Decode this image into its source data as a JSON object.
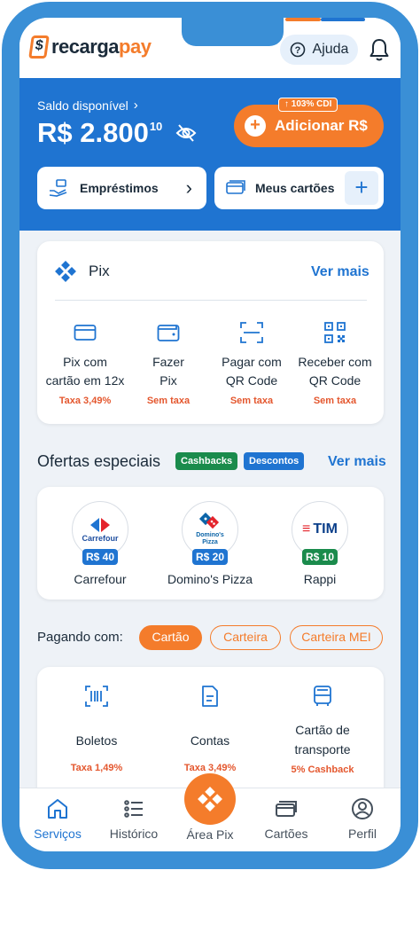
{
  "header": {
    "brand_a": "recarga",
    "brand_b": "pay",
    "help_label": "Ajuda"
  },
  "balance": {
    "label": "Saldo disponível",
    "amount": "R$ 2.800",
    "cents": "10",
    "cdi_badge": "103% CDI",
    "add_label": "Adicionar R$"
  },
  "quick": {
    "loans_label": "Empréstimos",
    "cards_label": "Meus cartões"
  },
  "pix": {
    "title": "Pix",
    "see_more": "Ver mais",
    "options": [
      {
        "line1": "Pix com",
        "line2": "cartão em 12x",
        "tax": "Taxa 3,49%",
        "icon": "card-icon"
      },
      {
        "line1": "Fazer",
        "line2": "Pix",
        "tax": "Sem taxa",
        "icon": "wallet-icon"
      },
      {
        "line1": "Pagar com",
        "line2": "QR Code",
        "tax": "Sem taxa",
        "icon": "scan-icon"
      },
      {
        "line1": "Receber com",
        "line2": "QR Code",
        "tax": "Sem taxa",
        "icon": "qr-code-icon"
      }
    ]
  },
  "offers": {
    "title": "Ofertas especiais",
    "tag_cashbacks": "Cashbacks",
    "tag_descontos": "Descontos",
    "see_more": "Ver mais",
    "items": [
      {
        "logo_text": "Carrefour",
        "price": "R$ 40",
        "name": "Carrefour",
        "price_color": "#1f74d1"
      },
      {
        "logo_text": "Domino's Pizza",
        "price": "R$ 20",
        "name": "Domino's Pizza",
        "price_color": "#1f74d1"
      },
      {
        "logo_text": "TIM",
        "price": "R$ 10",
        "name": "Rappi",
        "price_color": "#1a8b4c"
      }
    ]
  },
  "paying": {
    "label": "Pagando com:",
    "chips": [
      "Cartão",
      "Carteira",
      "Carteira MEI"
    ],
    "options": [
      {
        "line1": "Boletos",
        "line2": "",
        "tax": "Taxa 1,49%",
        "icon": "barcode-icon"
      },
      {
        "line1": "Contas",
        "line2": "",
        "tax": "Taxa 3,49%",
        "icon": "document-icon"
      },
      {
        "line1": "Cartão de",
        "line2": "transporte",
        "tax": "5% Cashback",
        "icon": "bus-icon"
      }
    ]
  },
  "nav": {
    "items": [
      "Serviços",
      "Histórico",
      "Área Pix",
      "Cartões",
      "Perfil"
    ],
    "active": "Serviços"
  },
  "colors": {
    "primary_blue": "#1f74d1",
    "accent_orange": "#f47c2b",
    "tax_red": "#e4572e"
  }
}
